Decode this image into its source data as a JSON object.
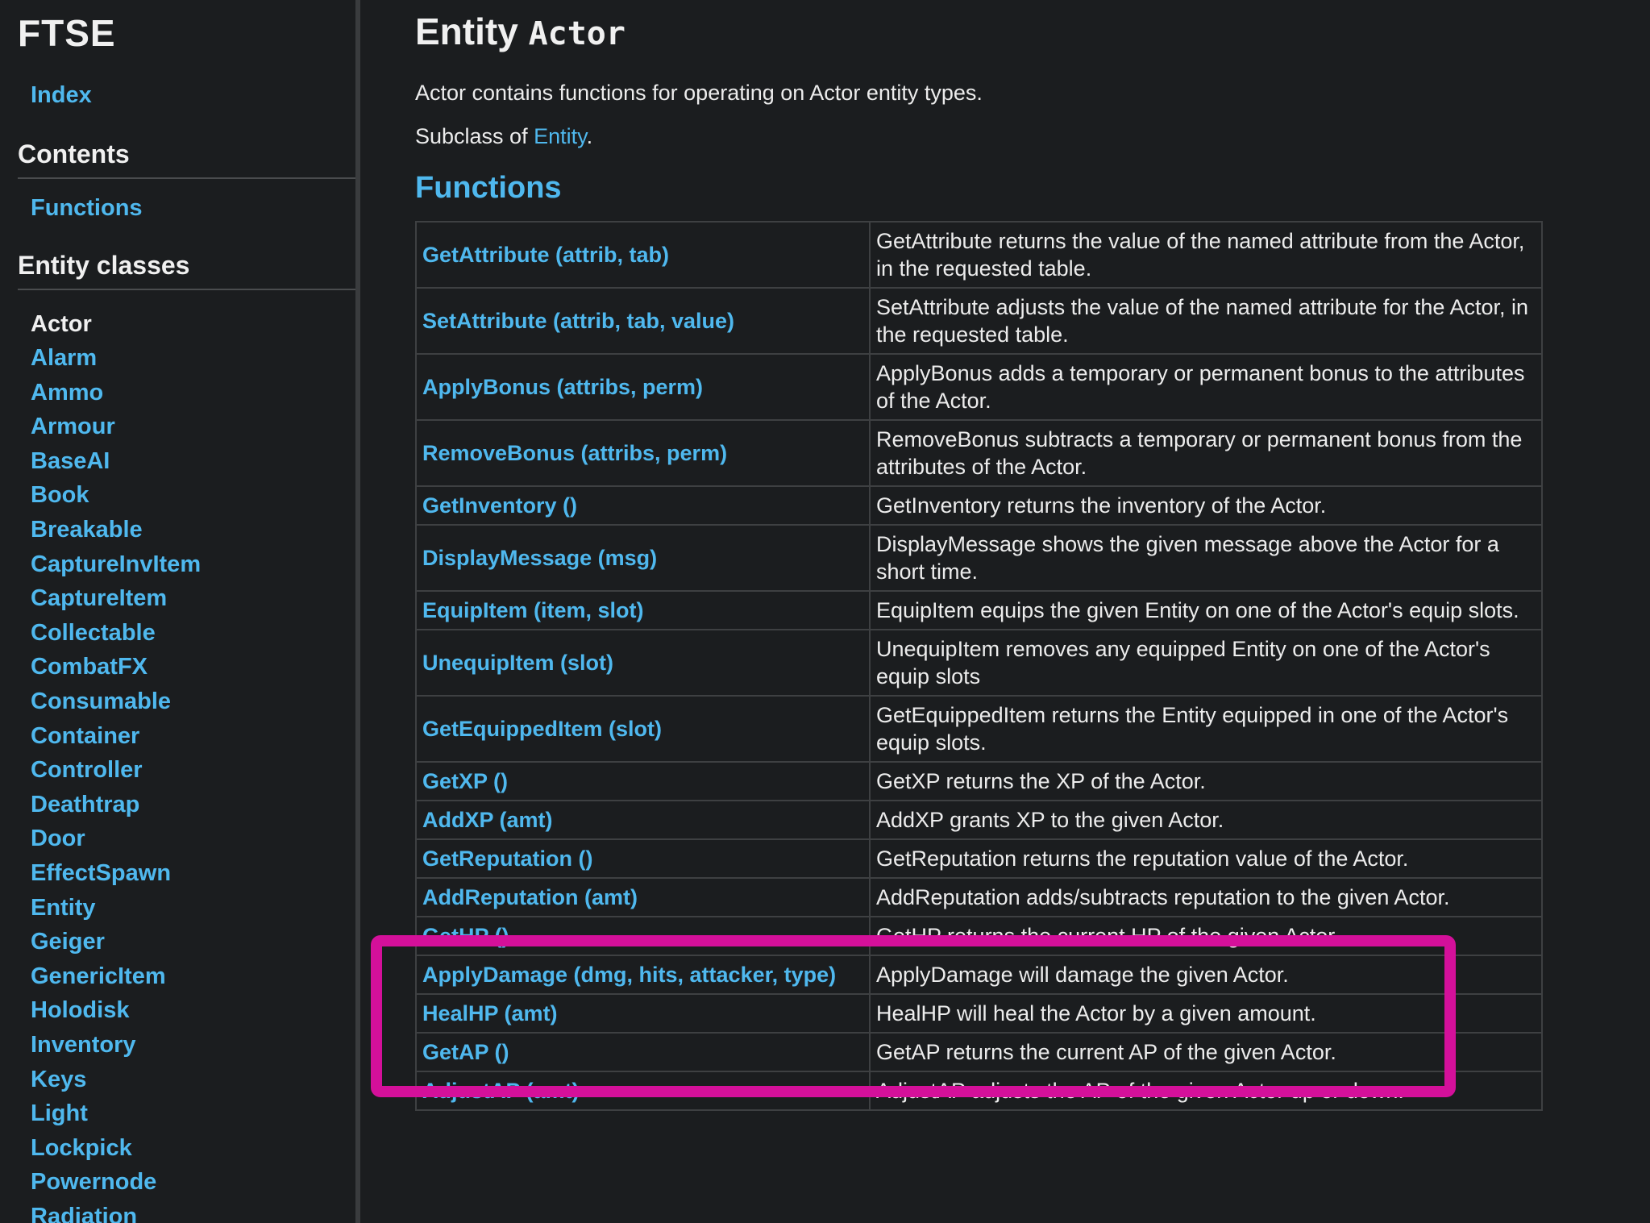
{
  "sidebar": {
    "brand": "FTSE",
    "index_link": "Index",
    "contents_heading": "Contents",
    "functions_link": "Functions",
    "entity_classes_heading": "Entity classes",
    "current_class": "Actor",
    "classes": [
      "Alarm",
      "Ammo",
      "Armour",
      "BaseAI",
      "Book",
      "Breakable",
      "CaptureInvItem",
      "CaptureItem",
      "Collectable",
      "CombatFX",
      "Consumable",
      "Container",
      "Controller",
      "Deathtrap",
      "Door",
      "EffectSpawn",
      "Entity",
      "Geiger",
      "GenericItem",
      "Holodisk",
      "Inventory",
      "Keys",
      "Light",
      "Lockpick",
      "Powernode",
      "Radiation"
    ]
  },
  "main": {
    "title_prefix": "Entity",
    "title_class": "Actor",
    "description": "Actor contains functions for operating on Actor entity types.",
    "subclass_prefix": "Subclass of",
    "subclass_link": "Entity",
    "subclass_suffix": ".",
    "functions_heading": "Functions",
    "functions": [
      {
        "name": "GetAttribute (attrib, tab)",
        "desc": "GetAttribute returns the value of the named attribute from the Actor, in the requested table."
      },
      {
        "name": "SetAttribute (attrib, tab, value)",
        "desc": "SetAttribute adjusts the value of the named attribute for the Actor, in the requested table."
      },
      {
        "name": "ApplyBonus (attribs, perm)",
        "desc": "ApplyBonus adds a temporary or permanent bonus to the attributes of the Actor."
      },
      {
        "name": "RemoveBonus (attribs, perm)",
        "desc": "RemoveBonus subtracts a temporary or permanent bonus from the attributes of the Actor."
      },
      {
        "name": "GetInventory ()",
        "desc": "GetInventory returns the inventory of the Actor."
      },
      {
        "name": "DisplayMessage (msg)",
        "desc": "DisplayMessage shows the given message above the Actor for a short time."
      },
      {
        "name": "EquipItem (item, slot)",
        "desc": "EquipItem equips the given Entity on one of the Actor's equip slots."
      },
      {
        "name": "UnequipItem (slot)",
        "desc": "UnequipItem removes any equipped Entity on one of the Actor's equip slots"
      },
      {
        "name": "GetEquippedItem (slot)",
        "desc": "GetEquippedItem returns the Entity equipped in one of the Actor's equip slots."
      },
      {
        "name": "GetXP ()",
        "desc": "GetXP returns the XP of the Actor."
      },
      {
        "name": "AddXP (amt)",
        "desc": "AddXP grants XP to the given Actor."
      },
      {
        "name": "GetReputation ()",
        "desc": "GetReputation returns the reputation value of the Actor."
      },
      {
        "name": "AddReputation (amt)",
        "desc": "AddReputation adds/subtracts reputation to the given Actor."
      },
      {
        "name": "GetHP ()",
        "desc": "GetHP returns the current HP of the given Actor."
      },
      {
        "name": "ApplyDamage (dmg, hits, attacker, type)",
        "desc": "ApplyDamage will damage the given Actor."
      },
      {
        "name": "HealHP (amt)",
        "desc": "HealHP will heal the Actor by a given amount."
      },
      {
        "name": "GetAP ()",
        "desc": "GetAP returns the current AP of the given Actor."
      },
      {
        "name": "AdjustAP (amt)",
        "desc": "AdjustAP adjusts the AP of the given Actor up or down."
      }
    ]
  },
  "colors": {
    "link": "#4fb8ee",
    "background": "#1b1d1f",
    "highlight": "#d4109a"
  }
}
